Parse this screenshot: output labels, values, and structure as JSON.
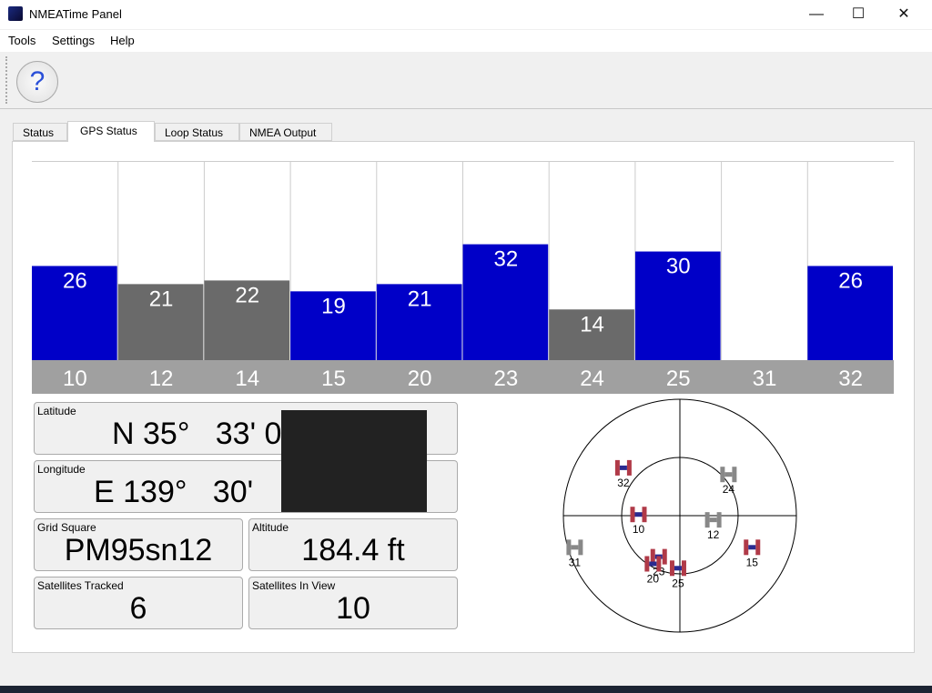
{
  "window": {
    "title": "NMEATime Panel",
    "minimize": "—",
    "maximize": "☐",
    "close": "✕"
  },
  "menu": [
    "Tools",
    "Settings",
    "Help"
  ],
  "toolbar": {
    "help_label": "?"
  },
  "tabs": [
    "Status",
    "GPS Status",
    "Loop Status",
    "NMEA Output"
  ],
  "active_tab": "GPS Status",
  "colors": {
    "tracked": "#0000c8",
    "not_tracked": "#6a6a6a",
    "label_bar": "#a0a0a0",
    "sky_used": "#b03a48",
    "sky_unused": "#888888"
  },
  "chart_data": {
    "type": "bar",
    "categories": [
      "10",
      "12",
      "14",
      "15",
      "20",
      "23",
      "24",
      "25",
      "31",
      "32"
    ],
    "values": [
      26,
      21,
      22,
      19,
      21,
      32,
      14,
      30,
      0,
      26
    ],
    "tracked": [
      true,
      false,
      false,
      true,
      true,
      true,
      false,
      true,
      false,
      true
    ],
    "ylim": [
      0,
      55
    ]
  },
  "info": {
    "latitude": {
      "label": "Latitude",
      "value": "N 35°   33' 0"
    },
    "longitude": {
      "label": "Longitude",
      "value": "E 139°   30'"
    },
    "grid": {
      "label": "Grid Square",
      "value": "PM95sn12"
    },
    "altitude": {
      "label": "Altitude",
      "value": "184.4 ft"
    },
    "tracked": {
      "label": "Satellites Tracked",
      "value": "6"
    },
    "in_view": {
      "label": "Satellites In View",
      "value": "10"
    }
  },
  "sky": [
    {
      "prn": "32",
      "az": 310,
      "el": 33,
      "used": true
    },
    {
      "prn": "24",
      "az": 50,
      "el": 41,
      "used": false
    },
    {
      "prn": "10",
      "az": 271,
      "el": 58,
      "used": true
    },
    {
      "prn": "12",
      "az": 98,
      "el": 64,
      "used": false
    },
    {
      "prn": "31",
      "az": 253,
      "el": 5,
      "used": false
    },
    {
      "prn": "15",
      "az": 114,
      "el": 29,
      "used": true
    },
    {
      "prn": "23",
      "az": 207,
      "el": 54,
      "used": true
    },
    {
      "prn": "20",
      "az": 209,
      "el": 47,
      "used": true
    },
    {
      "prn": "25",
      "az": 182,
      "el": 49,
      "used": true
    }
  ]
}
